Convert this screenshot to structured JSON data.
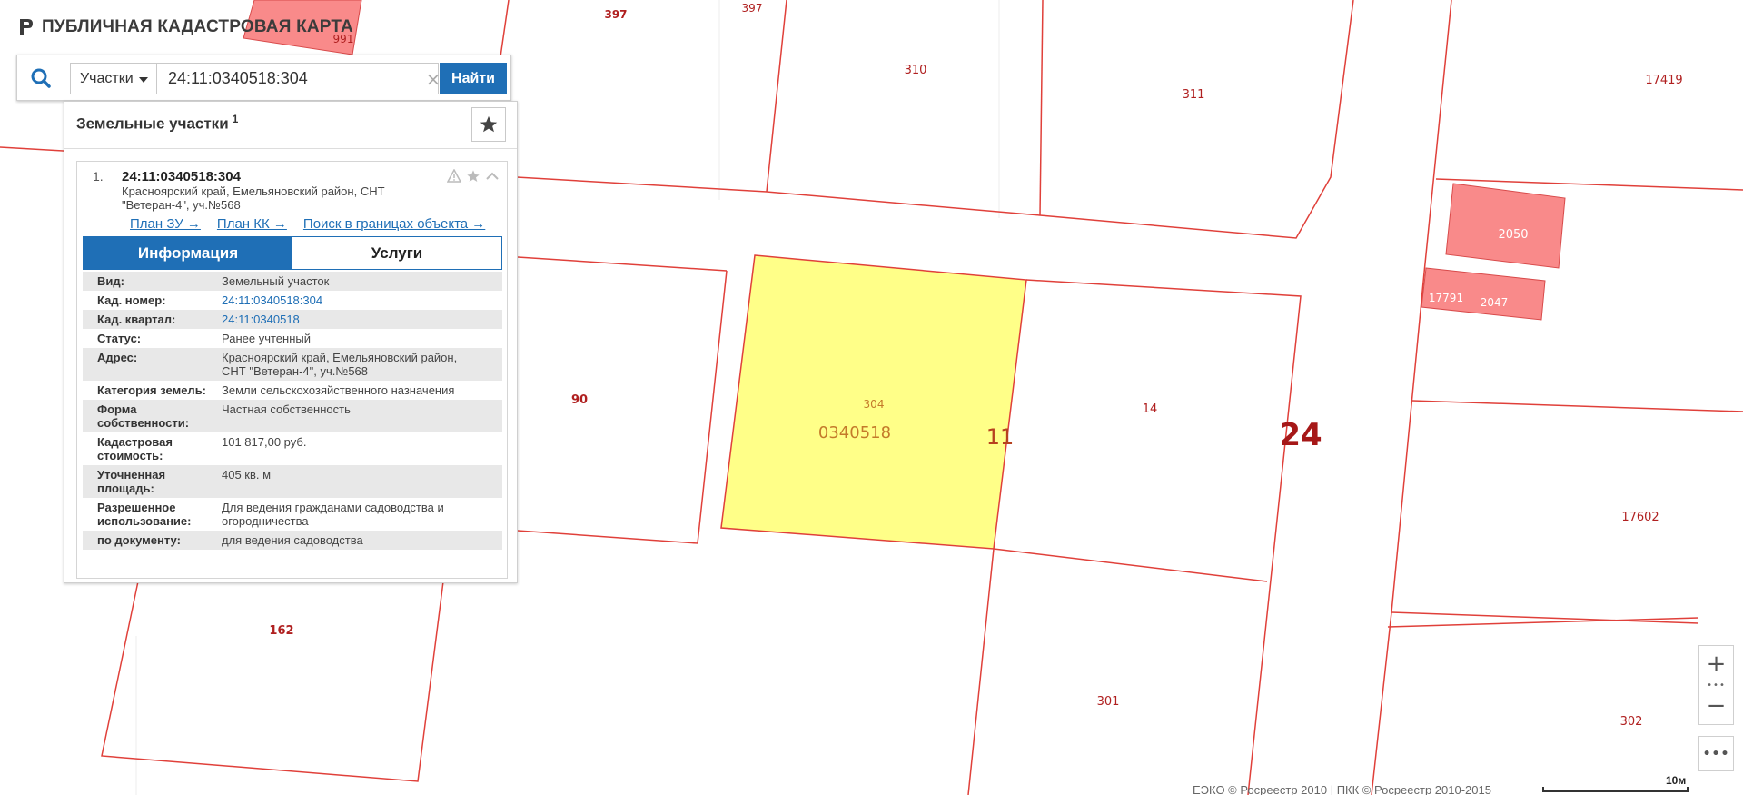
{
  "header": {
    "title": "ПУБЛИЧНАЯ КАДАСТРОВАЯ КАРТА",
    "logo_icon": "rosreestr-logo-icon"
  },
  "search": {
    "type_label": "Участки",
    "value": "24:11:0340518:304",
    "clear_symbol": "×",
    "find_label": "Найти"
  },
  "results": {
    "title": "Земельные участки",
    "count": "1",
    "item": {
      "index": "1.",
      "cadnum": "24:11:0340518:304",
      "address_line1": "Красноярский край, Емельяновский район, СНТ",
      "address_line2": "\"Ветеран-4\", уч.№568",
      "links": {
        "plan_zu": "План ЗУ →",
        "plan_kk": "План КК →",
        "search_bounds": "Поиск в границах объекта →"
      },
      "tabs": {
        "info": "Информация",
        "services": "Услуги"
      },
      "fields": {
        "vid_k": "Вид:",
        "vid_v": "Земельный участок",
        "kadnum_k": "Кад. номер:",
        "kadnum_v": "24:11:0340518:304",
        "kvartal_k": "Кад. квартал:",
        "kvartal_v": "24:11:0340518",
        "status_k": "Статус:",
        "status_v": "Ранее учтенный",
        "address_k": "Адрес:",
        "address_v1": "Красноярский край, Емельяновский район,",
        "address_v2": "СНТ \"Ветеран-4\", уч.№568",
        "category_k": "Категория земель:",
        "category_v": "Земли сельскохозяйственного назначения",
        "ownership_k1": "Форма",
        "ownership_k2": "собственности:",
        "ownership_v": "Частная собственность",
        "cost_k1": "Кадастровая",
        "cost_k2": "стоимость:",
        "cost_v": "101 817,00 руб.",
        "area_k1": "Уточненная",
        "area_k2": "площадь:",
        "area_v": "405 кв. м",
        "use_k1": "Разрешенное",
        "use_k2": "использование:",
        "use_v1": "Для ведения гражданами садоводства и",
        "use_v2": "огородничества",
        "doc_k": "по документу:",
        "doc_v": "для ведения садоводства"
      }
    }
  },
  "map": {
    "labels": {
      "l991": "991",
      "l397a": "397",
      "l397b": "397",
      "l310": "310",
      "l311": "311",
      "l17419": "17419",
      "l2050": "2050",
      "l17791": "17791",
      "l2047": "2047",
      "l90": "90",
      "l304": "304",
      "l0340518": "0340518",
      "l11": "11",
      "l14": "14",
      "l24": "24",
      "l17602": "17602",
      "l162": "162",
      "l301": "301",
      "l302": "302"
    },
    "colors": {
      "boundary": "#e0403a",
      "selected_fill": "#ffff88",
      "highlight_fill": "#f98a8a",
      "label": "#b02020"
    }
  },
  "zoom": {
    "in_symbol": "+",
    "out_symbol": "−",
    "mid_symbol": "•••"
  },
  "more_symbol": "•••",
  "copyright": "ЕЭКО © Росреестр 2010 | ПКК © Росреестр 2010-2015",
  "scale_label": "10м"
}
